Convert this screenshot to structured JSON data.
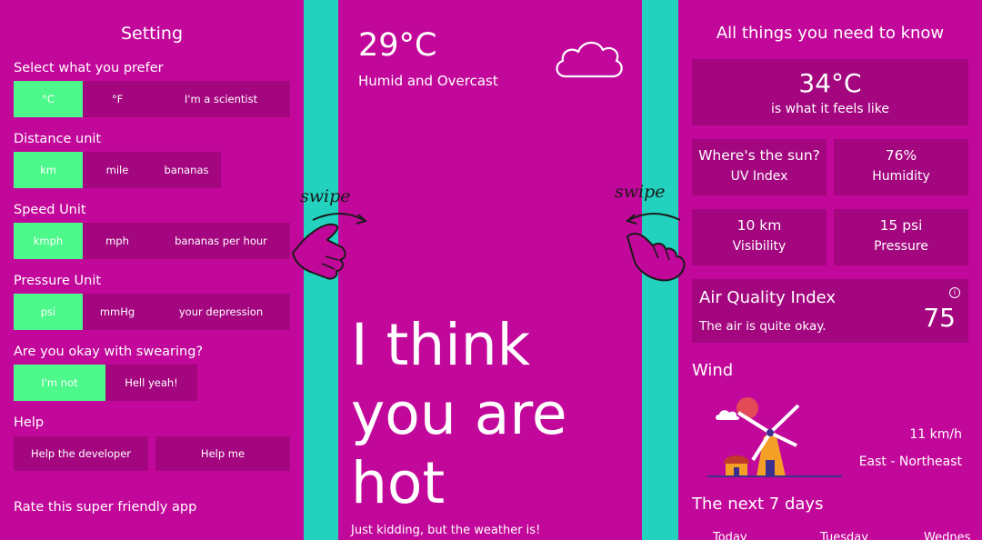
{
  "settings": {
    "title": "Setting",
    "temperature": {
      "label": "Select what you prefer",
      "options": [
        "°C",
        "°F",
        "I'm a scientist"
      ],
      "selected": "°C"
    },
    "distance": {
      "label": "Distance unit",
      "options": [
        "km",
        "mile",
        "bananas"
      ],
      "selected": "km"
    },
    "speed": {
      "label": "Speed Unit",
      "options": [
        "kmph",
        "mph",
        "bananas per hour"
      ],
      "selected": "kmph"
    },
    "pressure": {
      "label": "Pressure Unit",
      "options": [
        "psi",
        "mmHg",
        "your depression"
      ],
      "selected": "psi"
    },
    "swearing": {
      "label": "Are you okay with swearing?",
      "options": [
        "I'm not",
        "Hell yeah!"
      ],
      "selected": "I'm not"
    },
    "help": {
      "label": "Help",
      "developer": "Help the developer",
      "me": "Help me"
    },
    "rate": "Rate this super friendly app"
  },
  "home": {
    "temperature": "29°C",
    "condition": "Humid and Overcast",
    "big_text": [
      "I think",
      "you are",
      "hot"
    ],
    "subtext": "Just kidding, but the weather is!",
    "icon": "cloud-icon"
  },
  "details": {
    "title": "All things you need to know",
    "feels_like": {
      "value": "34°C",
      "label": "is what it feels like"
    },
    "uv": {
      "value": "Where's the sun?",
      "label": "UV Index"
    },
    "humidity": {
      "value": "76%",
      "label": "Humidity"
    },
    "visibility": {
      "value": "10 km",
      "label": "Visibility"
    },
    "pressure": {
      "value": "15 psi",
      "label": "Pressure"
    },
    "aqi": {
      "title": "Air Quality Index",
      "subtitle": "The air is quite okay.",
      "value": "75",
      "icon": "info-icon"
    },
    "wind": {
      "title": "Wind",
      "speed": "11 km/h",
      "direction": "East - Northeast",
      "icon": "windmill-icon"
    },
    "next_days": {
      "title": "The next 7 days",
      "days": [
        "Today",
        "Tuesday",
        "Wednes"
      ]
    }
  },
  "gestures": {
    "swipe_label": "swipe",
    "icon": "swipe-hand-icon"
  },
  "colors": {
    "background": "#C2089A",
    "card": "#A3067F",
    "active": "#4DF98A",
    "divider": "#22D1BE",
    "text": "#FFFFFF"
  }
}
